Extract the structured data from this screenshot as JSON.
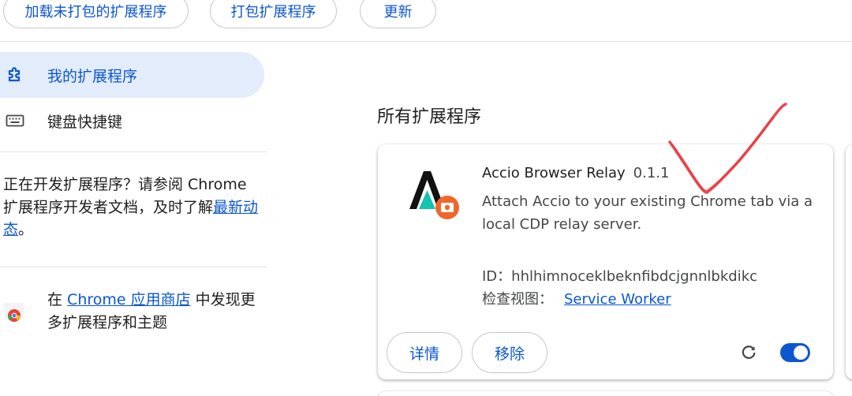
{
  "toolbar": {
    "load_unpacked": "加载未打包的扩展程序",
    "pack": "打包扩展程序",
    "update": "更新"
  },
  "sidebar": {
    "items": [
      {
        "label": "我的扩展程序",
        "icon": "puzzle-icon",
        "active": true
      },
      {
        "label": "键盘快捷键",
        "icon": "keyboard-icon",
        "active": false
      }
    ],
    "dev_text_prefix": "正在开发扩展程序？请参阅 Chrome 扩展程序开发者文档，及时了解",
    "dev_link": "最新动态",
    "dev_text_suffix": "。",
    "store_prefix": "在 ",
    "store_link": "Chrome 应用商店",
    "store_suffix": " 中发现更多扩展程序和主题"
  },
  "main": {
    "section_title": "所有扩展程序",
    "extension": {
      "name": "Accio Browser Relay",
      "version": "0.1.1",
      "description": "Attach Accio to your existing Chrome tab via a local CDP relay server.",
      "id_label": "ID：",
      "id_value": "hhlhimnoceklbeknfibdcjgnnlbkdikc",
      "inspect_label": "检查视图：",
      "inspect_link": "Service Worker",
      "details_button": "详情",
      "remove_button": "移除",
      "enabled": true
    }
  },
  "colors": {
    "accent": "#0b57d0",
    "active_bg": "#e3ecfa",
    "annotation": "#e8343c"
  }
}
